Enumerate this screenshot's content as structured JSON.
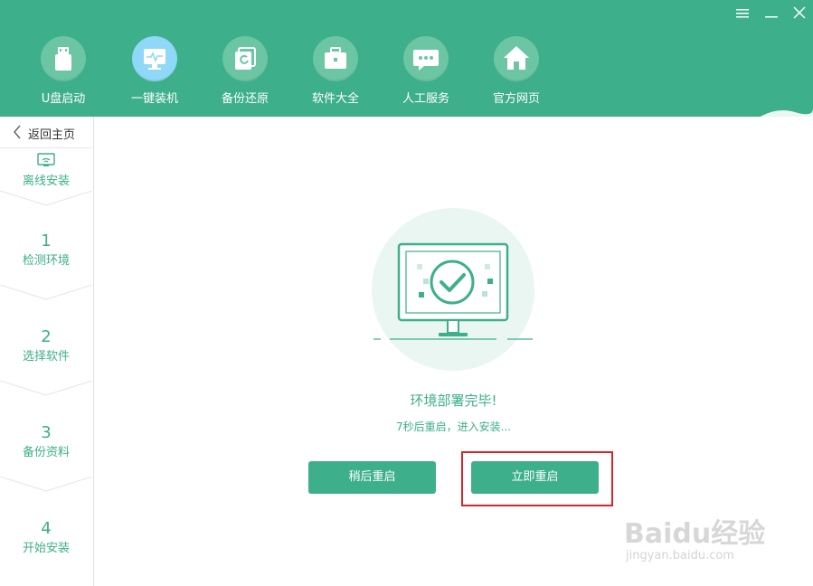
{
  "window_controls": [
    "menu-icon",
    "minimize-icon",
    "close-icon"
  ],
  "nav": {
    "items": [
      {
        "label": "U盘启动",
        "icon": "usb-icon"
      },
      {
        "label": "一键装机",
        "icon": "monitor-icon",
        "active": true
      },
      {
        "label": "备份还原",
        "icon": "backup-icon"
      },
      {
        "label": "软件大全",
        "icon": "briefcase-icon"
      },
      {
        "label": "人工服务",
        "icon": "chat-icon"
      },
      {
        "label": "官方网页",
        "icon": "home-icon"
      }
    ]
  },
  "sidebar": {
    "back_label": "返回主页",
    "offline_label": "离线安装",
    "steps": [
      {
        "num": "1",
        "label": "检测环境"
      },
      {
        "num": "2",
        "label": "选择软件"
      },
      {
        "num": "3",
        "label": "备份资料"
      },
      {
        "num": "4",
        "label": "开始安装"
      }
    ]
  },
  "main": {
    "status_title": "环境部署完毕!",
    "status_sub": "7秒后重启，进入安装...",
    "later_button": "稍后重启",
    "now_button": "立即重启"
  },
  "watermark": {
    "brand": "Baidu经验",
    "url": "jingyan.baidu.com"
  },
  "colors": {
    "accent": "#3daf8a",
    "highlight": "#d9242a"
  }
}
